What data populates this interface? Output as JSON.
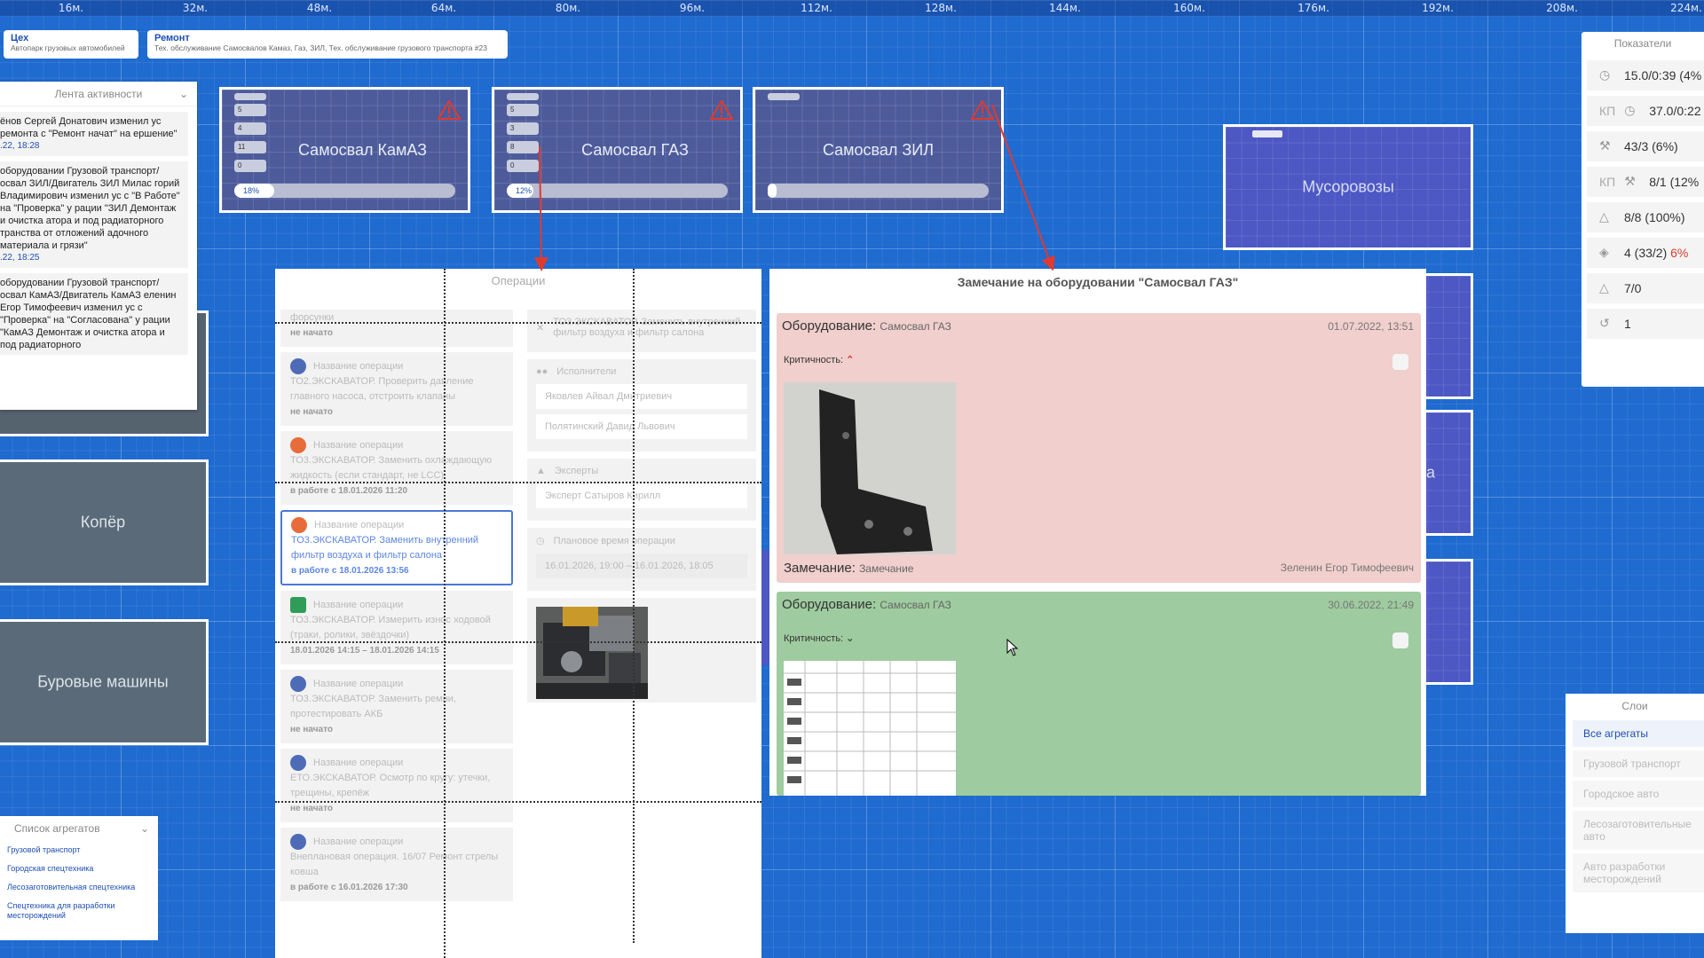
{
  "ruler": [
    "16м.",
    "32м.",
    "48м.",
    "64м.",
    "80м.",
    "96м.",
    "112м.",
    "128м.",
    "144м.",
    "160м.",
    "176м.",
    "192м.",
    "208м.",
    "224м."
  ],
  "breadcrumbs": [
    {
      "title": "Цех",
      "subtitle": "Автопарк грузовых автомобилей"
    },
    {
      "title": "Ремонт",
      "subtitle": "Тех. обслуживание Самосвалов Камаз, Газ, ЗИЛ, Тех. обслуживание грузового транспорта #23"
    }
  ],
  "activity": {
    "title": "Лента активности",
    "items": [
      {
        "text": "ёнов Сергей Донатович изменил ус ремонта с \"Ремонт начат\" на ершение\"",
        "date": ".22, 18:28"
      },
      {
        "text": "оборудовании Грузовой транспорт/ освал ЗИЛ/Двигатель ЗИЛ Милас горий Владимирович изменил ус с \"В Работе\" на \"Проверка\" у рации \"ЗИЛ Демонтаж и очистка атора и под радиаторного транства от отложений адочного материала и грязи\"",
        "date": ".22, 18:25"
      },
      {
        "text": "оборудовании Грузовой транспорт/ освал КамАЗ/Двигатель КамАЗ еленин Егор Тимофеевич изменил ус с \"Проверка\" на \"Согласована\" у рации \"КамАЗ Демонтаж и очистка атора и под радиаторного",
        "date": ""
      }
    ]
  },
  "equipment": [
    {
      "name": "Самосвал КамАЗ",
      "badges": [
        "5",
        "4",
        "11",
        "0"
      ],
      "progress": 18,
      "progress_label": "18%"
    },
    {
      "name": "Самосвал ГАЗ",
      "badges": [
        "5",
        "3",
        "8",
        "0"
      ],
      "progress": 12,
      "progress_label": "12%"
    },
    {
      "name": "Самосвал ЗИЛ",
      "badges": [],
      "progress": 0,
      "progress_label": ""
    }
  ],
  "equipment_big": {
    "name": "Мусоровозы",
    "partial_label": "ка"
  },
  "equipment_gray": [
    {
      "name": "Копёр"
    },
    {
      "name": "Буровые машины"
    }
  ],
  "operations": {
    "title": "Операции",
    "left": [
      {
        "label": "",
        "text": "форсунки",
        "status": "не начато",
        "icon_color": "#fff"
      },
      {
        "label": "Название операции",
        "text": "ТО2.ЭКСКАВАТОР. Проверить давление главного насоса, отстроить клапаны",
        "status": "не начато",
        "icon_color": "#4e6bb7"
      },
      {
        "label": "Название операции",
        "text": "ТО3.ЭКСКАВАТОР. Заменить охлаждающую жидкость (если стандарт, не LCC)",
        "status": "в работе с 18.01.2026 11:20",
        "icon_color": "#e86b3a"
      },
      {
        "label": "Название операции",
        "text": "ТО3.ЭКСКАВАТОР. Заменить внутренний фильтр воздуха и фильтр салона",
        "status": "в работе с 18.01.2026 13:56",
        "icon_color": "#e86b3a",
        "active": true
      },
      {
        "label": "Название операции",
        "text": "ТО3.ЭКСКАВАТОР. Измерить износ ходовой (траки, ролики, звёздочки)",
        "status": "18.01.2026 14:15 – 18.01.2026 14:15",
        "icon_color": "#2f9c57"
      },
      {
        "label": "Название операции",
        "text": "ТО3.ЭКСКАВАТОР. Заменить ремни, протестировать АКБ",
        "status": "не начато",
        "icon_color": "#4e6bb7"
      },
      {
        "label": "Название операции",
        "text": "ЕТО.ЭКСКАВАТОР. Осмотр по кругу: утечки, трещины, крепёж",
        "status": "не начато",
        "icon_color": "#4e6bb7"
      },
      {
        "label": "Название операции",
        "text": "Внеплановая операция. 16/07 Ремонт стрелы ковша",
        "status": "в работе с 16.01.2026 17:30",
        "icon_color": "#4e6bb7"
      }
    ],
    "right": {
      "operation": "ТО3.ЭКСКАВАТОР. Заменить внутренний фильтр воздуха и фильтр салона",
      "executors_label": "Исполнители",
      "executors": [
        "Яковлев Айвал Дмитриевич",
        "Полятинский Давид Львович"
      ],
      "experts_label": "Эксперты",
      "experts": [
        "Эксперт Сатыров Кирилл"
      ],
      "plan_label": "Плановое время операции",
      "plan_value": "16.01.2026, 19:00 – 16.01.2026, 18:05"
    }
  },
  "remark": {
    "title": "Замечание на оборудовании \"Самосвал ГАЗ\"",
    "cards": [
      {
        "equipment_label": "Оборудование:",
        "equipment": "Самосвал ГАЗ",
        "date": "01.07.2022, 13:51",
        "criticality_label": "Критичность:",
        "level": "high",
        "note_label": "Замечание:",
        "note": "Замечание",
        "author": "Зеленин Егор Тимофеевич"
      },
      {
        "equipment_label": "Оборудование:",
        "equipment": "Самосвал ГАЗ",
        "date": "30.06.2022, 21:49",
        "criticality_label": "Критичность:",
        "level": "low"
      }
    ]
  },
  "indicators": {
    "title": "Показатели",
    "items": [
      {
        "kp": "",
        "icon": "clock-icon",
        "value": "15.0/0:39 (4%"
      },
      {
        "kp": "КП",
        "icon": "clock-icon",
        "value": "37.0/0:22"
      },
      {
        "kp": "",
        "icon": "wrench-icon",
        "value": "43/3 (6%)"
      },
      {
        "kp": "КП",
        "icon": "wrench-icon",
        "value": "8/1 (12%"
      },
      {
        "kp": "",
        "icon": "helmet-icon",
        "value": "8/8 (100%)"
      },
      {
        "kp": "",
        "icon": "graduation-icon",
        "value": "4 (33/2) ",
        "extra": "6%"
      },
      {
        "kp": "",
        "icon": "warning-icon",
        "value": "7/0"
      },
      {
        "kp": "",
        "icon": "history-icon",
        "value": "1"
      }
    ]
  },
  "layers": {
    "title": "Слои",
    "items": [
      "Все агрегаты",
      "Грузовой транспорт",
      "Городское авто",
      "Лесозаготовительные авто",
      "Авто разработки месторождений"
    ]
  },
  "agg_list": {
    "title": "Список агрегатов",
    "items": [
      "Грузовой транспорт",
      "Городская спецтехника",
      "Лесозаготовительная спецтехника",
      "Спецтехника для разработки месторождений"
    ]
  },
  "colors": {
    "accent": "#1e4fb5",
    "red_card": "#f0cfcc",
    "green_card": "#9ecb9f",
    "alert": "#e03a2f"
  }
}
